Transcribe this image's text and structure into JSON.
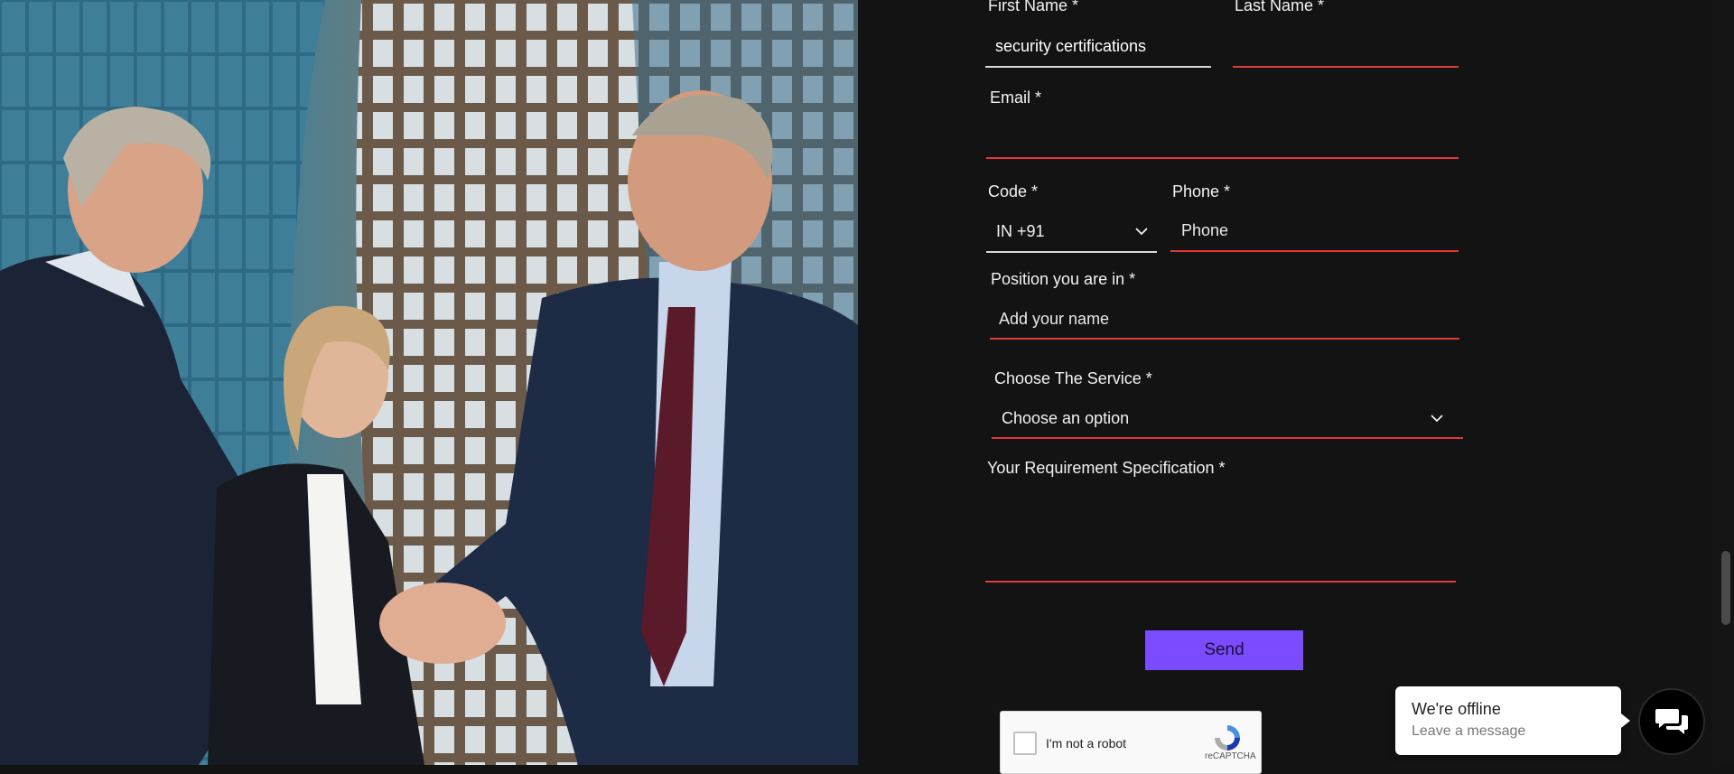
{
  "form": {
    "first_name": {
      "label": "First Name *",
      "value": "security certifications"
    },
    "last_name": {
      "label": "Last Name *",
      "value": ""
    },
    "email": {
      "label": "Email *",
      "value": ""
    },
    "code": {
      "label": "Code *",
      "selected": "IN +91"
    },
    "phone": {
      "label": "Phone *",
      "placeholder": "Phone"
    },
    "position": {
      "label": "Position you are in *",
      "placeholder": "Add your name"
    },
    "service": {
      "label": "Choose The Service *",
      "selected": "Choose an option"
    },
    "requirement": {
      "label": "Your Requirement Specification *",
      "value": ""
    },
    "send_label": "Send"
  },
  "recaptcha": {
    "label": "I'm not a robot",
    "brand": "reCAPTCHA"
  },
  "chat": {
    "title": "We're offline",
    "subtitle": "Leave a message"
  },
  "colors": {
    "accent": "#7b4cff",
    "error_underline": "#e03a3a",
    "background": "#131313"
  }
}
